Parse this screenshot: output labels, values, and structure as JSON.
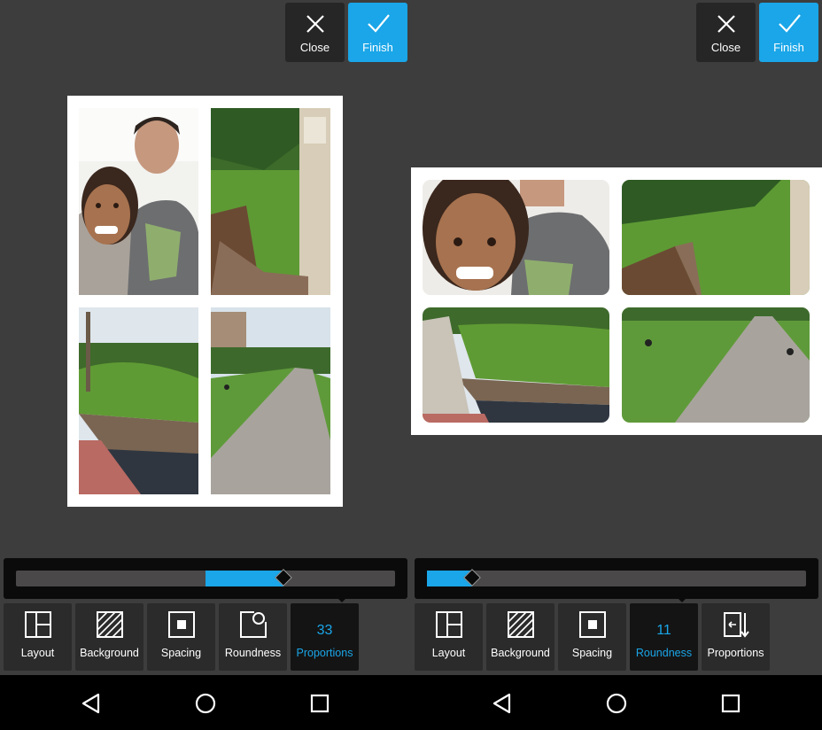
{
  "colors": {
    "accent": "#1aa6e8",
    "screen_bg": "#3d3d3d",
    "toolbar_bg": "#2b2b2b"
  },
  "left": {
    "header": {
      "close_label": "Close",
      "finish_label": "Finish"
    },
    "slider": {
      "value": 33,
      "fraction": 0.705,
      "fill_start": 0.5
    },
    "tools": [
      {
        "label": "Layout",
        "icon": "layout-icon"
      },
      {
        "label": "Background",
        "icon": "background-icon"
      },
      {
        "label": "Spacing",
        "icon": "spacing-icon"
      },
      {
        "label": "Roundness",
        "icon": "roundness-icon"
      },
      {
        "label": "Proportions",
        "icon": "proportions-icon",
        "value": "33",
        "active": true
      }
    ]
  },
  "right": {
    "header": {
      "close_label": "Close",
      "finish_label": "Finish"
    },
    "slider": {
      "value": 11,
      "fraction": 0.12,
      "fill_start": 0.0
    },
    "tools": [
      {
        "label": "Layout",
        "icon": "layout-icon"
      },
      {
        "label": "Background",
        "icon": "background-icon"
      },
      {
        "label": "Spacing",
        "icon": "spacing-icon"
      },
      {
        "label": "Roundness",
        "icon": "roundness-icon",
        "value": "11",
        "active": true
      },
      {
        "label": "Proportions",
        "icon": "proportions-icon"
      }
    ]
  },
  "navbar": {
    "icons": [
      "back-icon",
      "home-icon",
      "recents-icon"
    ]
  }
}
